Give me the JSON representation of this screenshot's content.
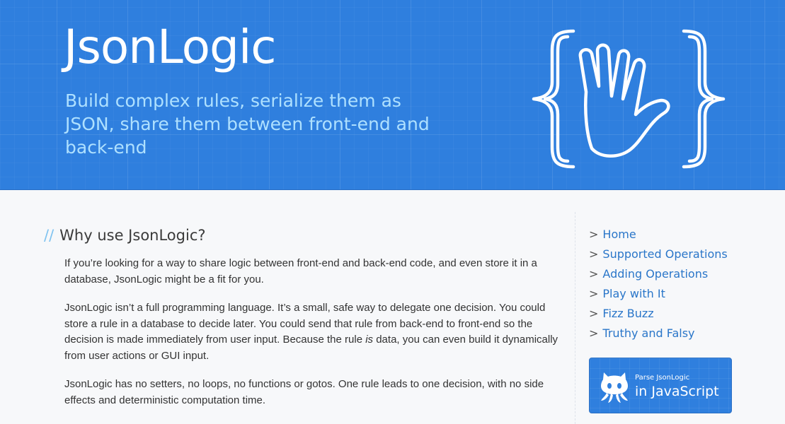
{
  "header": {
    "title": "JsonLogic",
    "tagline": "Build complex rules, serialize them as JSON, share them between front-end and back-end",
    "logo_icon": "vulcan-salute-braces-logo"
  },
  "main": {
    "heading_prefix": "//",
    "heading": "Why use JsonLogic?",
    "paragraph1": "If you’re looking for a way to share logic between front-end and back-end code, and even store it in a database, JsonLogic might be a fit for you.",
    "paragraph2_before": "JsonLogic isn’t a full programming language. It’s a small, safe way to delegate one decision. You could store a rule in a database to decide later. You could send that rule from back-end to front-end so the decision is made immediately from user input. Because the rule ",
    "paragraph2_em": "is",
    "paragraph2_after": " data, you can even build it dynamically from user actions or GUI input.",
    "paragraph3": "JsonLogic has no setters, no loops, no functions or gotos. One rule leads to one decision, with no side effects and deterministic computation time."
  },
  "sidebar": {
    "arrow": ">",
    "items": [
      {
        "label": "Home"
      },
      {
        "label": "Supported Operations"
      },
      {
        "label": "Adding Operations"
      },
      {
        "label": "Play with It"
      },
      {
        "label": "Fizz Buzz"
      },
      {
        "label": "Truthy and Falsy"
      }
    ]
  },
  "badge": {
    "small_text": "Parse JsonLogic",
    "big_text": "in JavaScript",
    "icon": "github-octocat-icon"
  },
  "colors": {
    "header_bg": "#2f7fde",
    "tagline": "#aee0ff",
    "link": "#2a76c9",
    "heading_slashes": "#7fc3f0",
    "page_bg": "#f7f8fa"
  }
}
